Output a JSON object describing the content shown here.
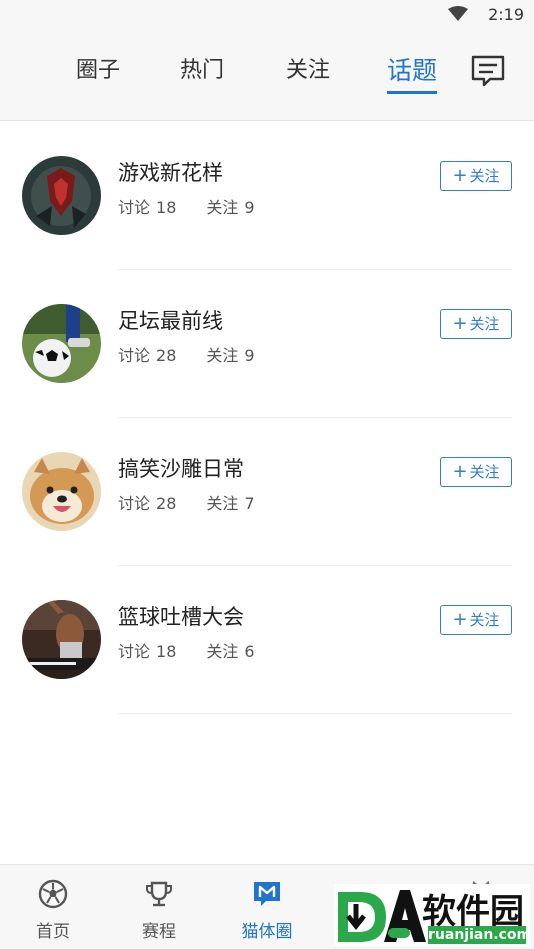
{
  "status_bar": {
    "time": "2:19"
  },
  "tabs": [
    {
      "label": "圈子",
      "active": false
    },
    {
      "label": "热门",
      "active": false
    },
    {
      "label": "关注",
      "active": false
    },
    {
      "label": "话题",
      "active": true
    }
  ],
  "header": {
    "message_icon": "message-icon"
  },
  "topics": [
    {
      "name": "游戏新花样",
      "discuss_label": "讨论",
      "discuss_count": "18",
      "follow_label": "关注",
      "follow_count": "9",
      "button": "关注"
    },
    {
      "name": "足坛最前线",
      "discuss_label": "讨论",
      "discuss_count": "28",
      "follow_label": "关注",
      "follow_count": "9",
      "button": "关注"
    },
    {
      "name": "搞笑沙雕日常",
      "discuss_label": "讨论",
      "discuss_count": "28",
      "follow_label": "关注",
      "follow_count": "7",
      "button": "关注"
    },
    {
      "name": "篮球吐槽大会",
      "discuss_label": "讨论",
      "discuss_count": "18",
      "follow_label": "关注",
      "follow_count": "6",
      "button": "关注"
    }
  ],
  "bottom_nav": [
    {
      "label": "首页",
      "icon": "soccer-ball-icon",
      "active": false
    },
    {
      "label": "赛程",
      "icon": "trophy-icon",
      "active": false
    },
    {
      "label": "猫体圈",
      "icon": "m-chat-icon",
      "active": true
    }
  ],
  "watermark": {
    "brand": "软件园",
    "url": "ruanjian.com",
    "letters": "DA"
  },
  "colors": {
    "accent": "#1f74cf",
    "text": "#222222",
    "muted": "#555555",
    "bar_bg": "#f7f7f7",
    "watermark_green": "#2aa84a"
  }
}
